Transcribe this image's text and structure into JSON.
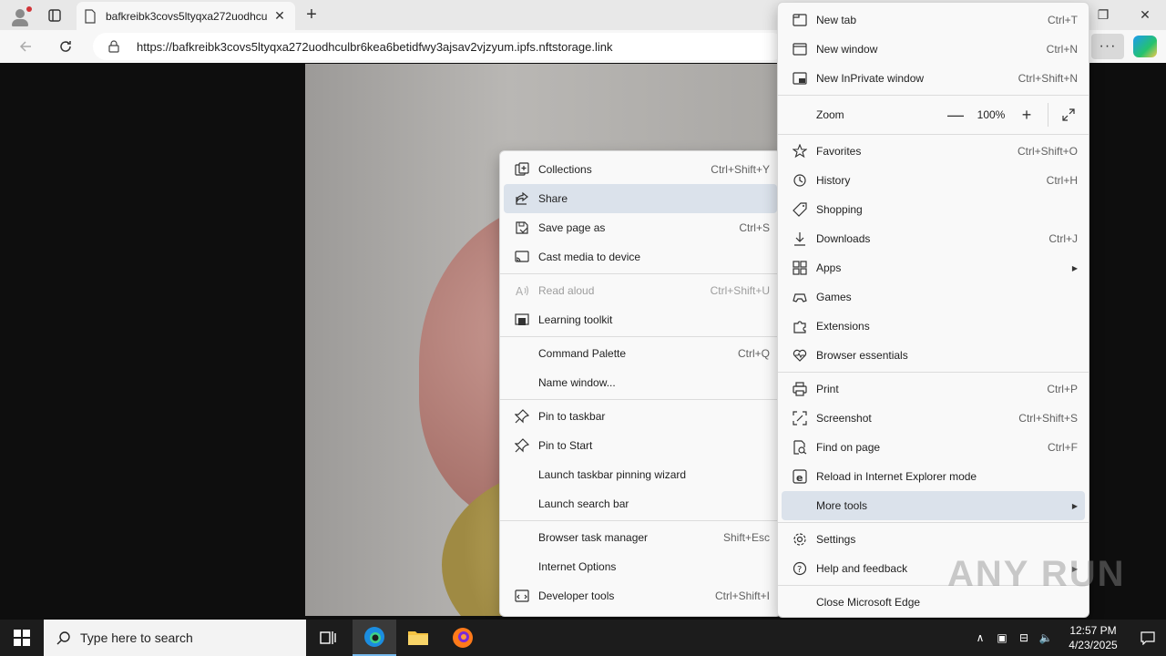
{
  "tab": {
    "title": "bafkreibk3covs5ltyqxa272uodhcu",
    "close_label": "✕"
  },
  "address": {
    "url": "https://bafkreibk3covs5ltyqxa272uodhculbr6kea6betidfwy3ajsav2vjzyum.ipfs.nftstorage.link"
  },
  "toolbar": {
    "more_label": "···"
  },
  "main_menu": {
    "items": [
      {
        "label": "New tab",
        "shortcut": "Ctrl+T",
        "icon": "new-tab-icon"
      },
      {
        "label": "New window",
        "shortcut": "Ctrl+N",
        "icon": "new-window-icon"
      },
      {
        "label": "New InPrivate window",
        "shortcut": "Ctrl+Shift+N",
        "icon": "inprivate-icon"
      },
      {
        "label": "Favorites",
        "shortcut": "Ctrl+Shift+O",
        "icon": "star-icon"
      },
      {
        "label": "History",
        "shortcut": "Ctrl+H",
        "icon": "history-icon"
      },
      {
        "label": "Shopping",
        "shortcut": "",
        "icon": "tag-icon"
      },
      {
        "label": "Downloads",
        "shortcut": "Ctrl+J",
        "icon": "download-icon"
      },
      {
        "label": "Apps",
        "shortcut": "",
        "icon": "apps-icon"
      },
      {
        "label": "Games",
        "shortcut": "",
        "icon": "games-icon"
      },
      {
        "label": "Extensions",
        "shortcut": "",
        "icon": "puzzle-icon"
      },
      {
        "label": "Browser essentials",
        "shortcut": "",
        "icon": "heart-pulse-icon"
      },
      {
        "label": "Print",
        "shortcut": "Ctrl+P",
        "icon": "printer-icon"
      },
      {
        "label": "Screenshot",
        "shortcut": "Ctrl+Shift+S",
        "icon": "screenshot-icon"
      },
      {
        "label": "Find on page",
        "shortcut": "Ctrl+F",
        "icon": "find-icon"
      },
      {
        "label": "Reload in Internet Explorer mode",
        "shortcut": "",
        "icon": "ie-icon"
      },
      {
        "label": "More tools",
        "shortcut": "",
        "icon": ""
      },
      {
        "label": "Settings",
        "shortcut": "",
        "icon": "gear-icon"
      },
      {
        "label": "Help and feedback",
        "shortcut": "",
        "icon": "help-icon"
      },
      {
        "label": "Close Microsoft Edge",
        "shortcut": "",
        "icon": ""
      }
    ],
    "zoom": {
      "label": "Zoom",
      "value": "100%",
      "minus": "—",
      "plus": "+"
    }
  },
  "sub_menu": {
    "items": [
      {
        "label": "Collections",
        "shortcut": "Ctrl+Shift+Y",
        "icon": "collections-icon"
      },
      {
        "label": "Share",
        "shortcut": "",
        "icon": "share-icon"
      },
      {
        "label": "Save page as",
        "shortcut": "Ctrl+S",
        "icon": "save-icon"
      },
      {
        "label": "Cast media to device",
        "shortcut": "",
        "icon": "cast-icon"
      },
      {
        "label": "Read aloud",
        "shortcut": "Ctrl+Shift+U",
        "icon": "read-aloud-icon"
      },
      {
        "label": "Learning toolkit",
        "shortcut": "",
        "icon": "learning-icon"
      },
      {
        "label": "Command Palette",
        "shortcut": "Ctrl+Q",
        "icon": ""
      },
      {
        "label": "Name window...",
        "shortcut": "",
        "icon": ""
      },
      {
        "label": "Pin to taskbar",
        "shortcut": "",
        "icon": "pin-icon"
      },
      {
        "label": "Pin to Start",
        "shortcut": "",
        "icon": "pin-icon"
      },
      {
        "label": "Launch taskbar pinning wizard",
        "shortcut": "",
        "icon": ""
      },
      {
        "label": "Launch search bar",
        "shortcut": "",
        "icon": ""
      },
      {
        "label": "Browser task manager",
        "shortcut": "Shift+Esc",
        "icon": ""
      },
      {
        "label": "Internet Options",
        "shortcut": "",
        "icon": ""
      },
      {
        "label": "Developer tools",
        "shortcut": "Ctrl+Shift+I",
        "icon": "devtools-icon"
      }
    ]
  },
  "taskbar": {
    "search_placeholder": "Type here to search",
    "time": "12:57 PM",
    "date": "4/23/2025"
  },
  "watermark": "ANY RUN",
  "colors": {
    "selected": "#dbe2eb",
    "taskbar": "#1c1c1c",
    "menu_bg": "#f9f9f9"
  }
}
